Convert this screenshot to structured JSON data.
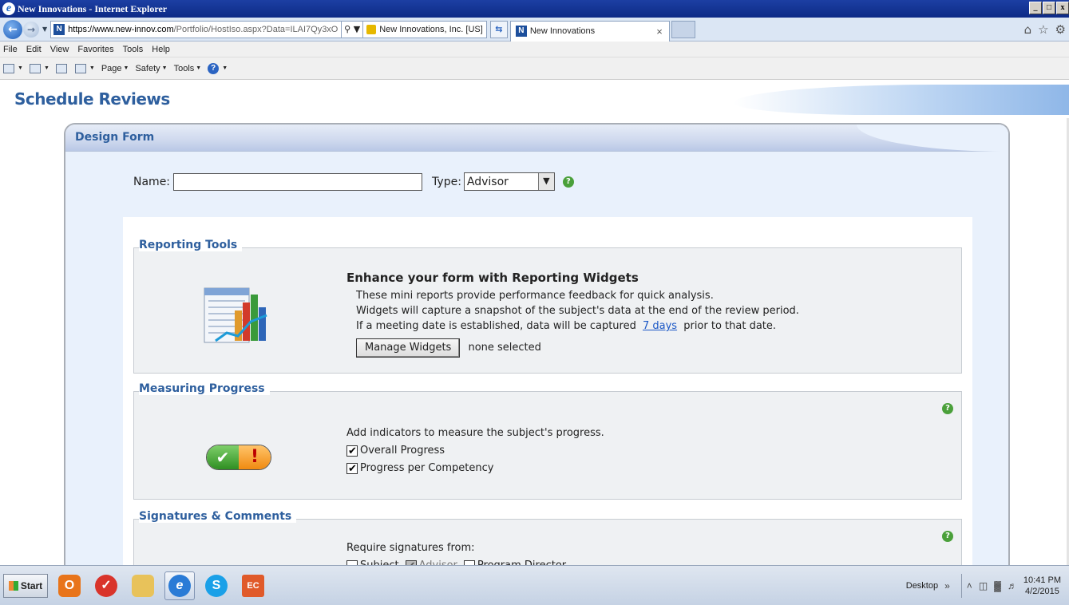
{
  "window": {
    "title": "New Innovations - Internet Explorer",
    "controls": [
      "_",
      "□",
      "x"
    ]
  },
  "browser": {
    "url_scheme_host": "https://www.new-innov.com",
    "url_path": "/Portfolio/HostIso.aspx?Data=ILAI7Qy3xO",
    "security_label": "New Innovations, Inc. [US]",
    "tab_title": "New Innovations",
    "menu": [
      "File",
      "Edit",
      "View",
      "Favorites",
      "Tools",
      "Help"
    ],
    "command_bar": [
      "Page",
      "Safety",
      "Tools"
    ]
  },
  "page": {
    "title": "Schedule Reviews"
  },
  "design_form": {
    "header": "Design Form",
    "name_label": "Name:",
    "name_value": "",
    "type_label": "Type:",
    "type_value": "Advisor"
  },
  "reporting_tools": {
    "title": "Reporting Tools",
    "heading": "Enhance your form with Reporting Widgets",
    "line1": "These mini reports provide performance feedback for quick analysis.",
    "line2": "Widgets will capture a snapshot of the subject's data at the end of the review period.",
    "line3_pre": "If a meeting date is established, data will be captured",
    "line3_link": "7 days",
    "line3_post": "prior to that date.",
    "button": "Manage Widgets",
    "status": "none selected"
  },
  "measuring_progress": {
    "title": "Measuring Progress",
    "intro": "Add indicators to measure the subject's progress.",
    "options": [
      {
        "label": "Overall Progress",
        "checked": true
      },
      {
        "label": "Progress per Competency",
        "checked": true
      }
    ]
  },
  "signatures": {
    "title": "Signatures & Comments",
    "intro": "Require signatures from:",
    "options": [
      {
        "label": "Subject",
        "checked": false
      },
      {
        "label": "Advisor",
        "checked": true
      },
      {
        "label": "Program Director",
        "checked": false
      }
    ]
  },
  "taskbar": {
    "start": "Start",
    "desktop": "Desktop",
    "time": "10:41 PM",
    "date": "4/2/2015"
  },
  "colors": {
    "accent": "#2e5f9e",
    "help_green": "#4aa03a",
    "link": "#1a57c6"
  }
}
